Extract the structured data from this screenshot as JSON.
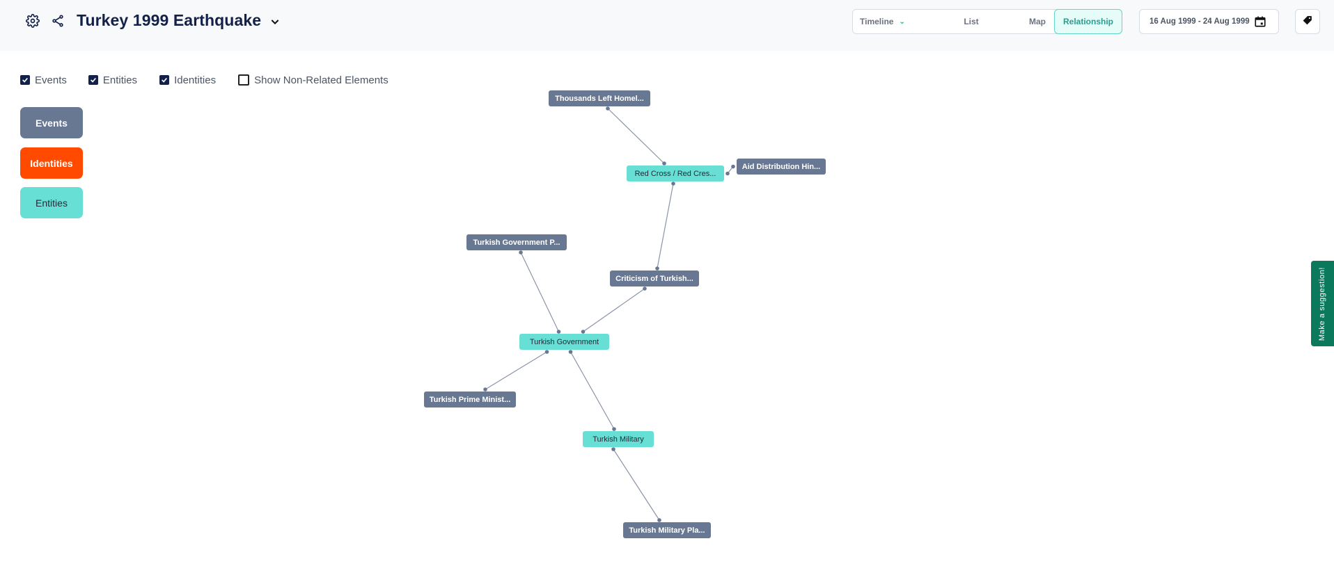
{
  "header": {
    "title": "Turkey 1999 Earthquake",
    "icons": [
      "gear-icon",
      "share-icon",
      "chevron-down-icon"
    ]
  },
  "view_tabs": [
    {
      "label": "Timeline",
      "has_dropdown": true,
      "active": false
    },
    {
      "label": "List",
      "active": false
    },
    {
      "label": "Map",
      "active": false
    },
    {
      "label": "Relationship",
      "active": true
    }
  ],
  "date_range": {
    "label": "16 Aug 1999 - 24 Aug 1999",
    "icon": "calendar-icon"
  },
  "tag_button": {
    "icon": "tag-icon"
  },
  "filters": [
    {
      "label": "Events",
      "checked": true
    },
    {
      "label": "Entities",
      "checked": true
    },
    {
      "label": "Identities",
      "checked": true
    },
    {
      "label": "Show Non-Related Elements",
      "checked": false
    }
  ],
  "legend": [
    {
      "label": "Events",
      "color": "#687792"
    },
    {
      "label": "Identities",
      "color": "#ff4a00"
    },
    {
      "label": "Entities",
      "color": "#67dfd4"
    }
  ],
  "graph": {
    "nodes": [
      {
        "id": "n1",
        "label": "Thousands Left Homel...",
        "type": "event"
      },
      {
        "id": "n2",
        "label": "Red Cross / Red Cres...",
        "type": "entity"
      },
      {
        "id": "n3",
        "label": "Aid Distribution Hin...",
        "type": "event"
      },
      {
        "id": "n4",
        "label": "Turkish Government P...",
        "type": "event"
      },
      {
        "id": "n5",
        "label": "Criticism of Turkish...",
        "type": "event"
      },
      {
        "id": "n6",
        "label": "Turkish Government",
        "type": "entity"
      },
      {
        "id": "n7",
        "label": "Turkish Prime Minist...",
        "type": "event"
      },
      {
        "id": "n8",
        "label": "Turkish Military",
        "type": "entity"
      },
      {
        "id": "n9",
        "label": "Turkish Military Pla...",
        "type": "event"
      }
    ],
    "edges": [
      {
        "from": "n1",
        "to": "n2"
      },
      {
        "from": "n2",
        "to": "n3"
      },
      {
        "from": "n2",
        "to": "n5"
      },
      {
        "from": "n4",
        "to": "n6"
      },
      {
        "from": "n5",
        "to": "n6"
      },
      {
        "from": "n6",
        "to": "n7"
      },
      {
        "from": "n6",
        "to": "n8"
      },
      {
        "from": "n8",
        "to": "n9"
      }
    ],
    "colors": {
      "event": "#687792",
      "entity": "#67dfd4",
      "edge": "#8a94a8"
    }
  },
  "suggestion_tab": {
    "label": "Make a suggestion!"
  }
}
